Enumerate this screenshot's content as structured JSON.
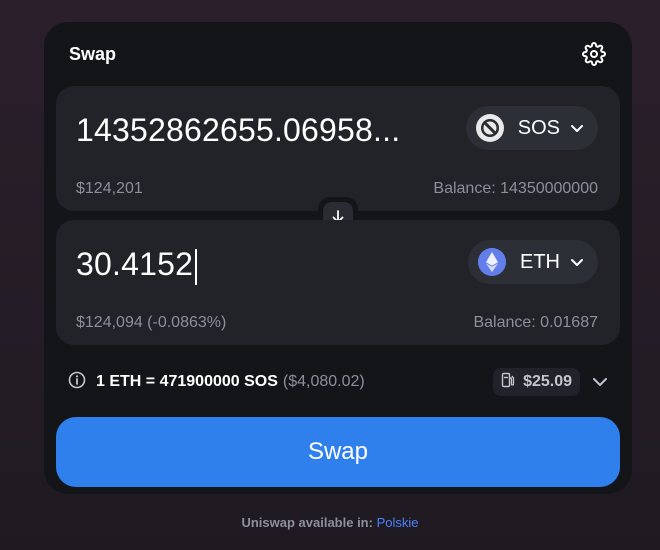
{
  "widget": {
    "title": "Swap",
    "settings_icon": "gear-icon"
  },
  "input": {
    "amount": "14352862655.06958...",
    "token": "SOS",
    "token_icon": "sos-token-icon",
    "usd": "$124,201",
    "balance": "Balance: 14350000000"
  },
  "switch_icon": "arrow-down-icon",
  "output": {
    "amount": "30.4152",
    "token": "ETH",
    "token_icon": "eth-token-icon",
    "usd": "$124,094 (-0.0863%)",
    "balance": "Balance: 0.01687"
  },
  "rate": {
    "text": "1 ETH = 471900000 SOS",
    "usd": "($4,080.02)",
    "gas": "$25.09"
  },
  "swap_button": "Swap",
  "footer": {
    "prefix": "Uniswap available in:",
    "link": "Polskie"
  },
  "colors": {
    "accent": "#2f80ed",
    "card": "#141519",
    "panel": "#222329",
    "muted_text": "#8c8f9c",
    "eth": "#627eea"
  }
}
